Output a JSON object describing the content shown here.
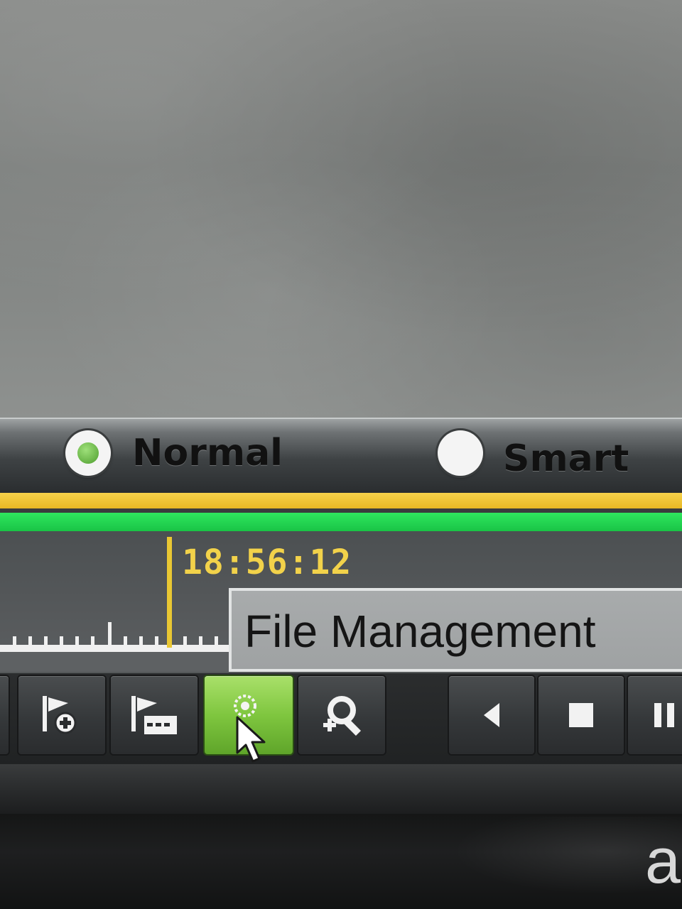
{
  "mode_selector": {
    "options": [
      {
        "label": "Normal",
        "selected": true
      },
      {
        "label": "Smart",
        "selected": false
      }
    ]
  },
  "timeline": {
    "current_time": "18:56:12"
  },
  "tooltip": {
    "text": "File Management"
  },
  "toolbar": {
    "buttons": [
      {
        "icon": "add-tag-icon",
        "active": false
      },
      {
        "icon": "tag-list-icon",
        "active": false
      },
      {
        "icon": "file-management-icon",
        "active": true
      },
      {
        "icon": "zoom-in-icon",
        "active": false
      },
      {
        "icon": "reverse-play-icon",
        "active": false
      },
      {
        "icon": "stop-icon",
        "active": false
      },
      {
        "icon": "pause-icon",
        "active": false
      }
    ]
  },
  "colors": {
    "recording_normal": "#e8b824",
    "recording_continuous": "#19c446",
    "time_label": "#f2d24a",
    "active_button": "#7fc63f"
  }
}
